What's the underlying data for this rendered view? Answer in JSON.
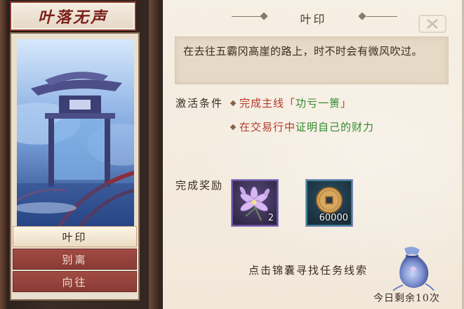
{
  "left_panel": {
    "title": "叶落无声",
    "list": [
      "叶印",
      "别离",
      "向往"
    ],
    "active_index": 0
  },
  "detail": {
    "title": "叶印",
    "description": "在去往五霸冈高崖的路上，时不时会有微风吹过。",
    "conditions_label": "激活条件",
    "conditions": [
      {
        "red": "完成主线「",
        "green": "功亏一篑",
        "red_end": "」"
      },
      {
        "red": "在交易行中",
        "green": "证明自己的财力",
        "red_end": ""
      }
    ],
    "rewards_label": "完成奖励",
    "rewards": [
      {
        "icon": "lavender-flower-icon",
        "count": "2",
        "rarity": "purple"
      },
      {
        "icon": "copper-coin-icon",
        "count": "60000",
        "rarity": "blue"
      }
    ],
    "hint": "点击锦囊寻找任务线索",
    "remaining": "今日剩余10次"
  },
  "colors": {
    "condition_red": "#b53a2c",
    "condition_green": "#2f8a2c",
    "active_tab": "#f5ead8",
    "inactive_tab": "#953f38"
  }
}
